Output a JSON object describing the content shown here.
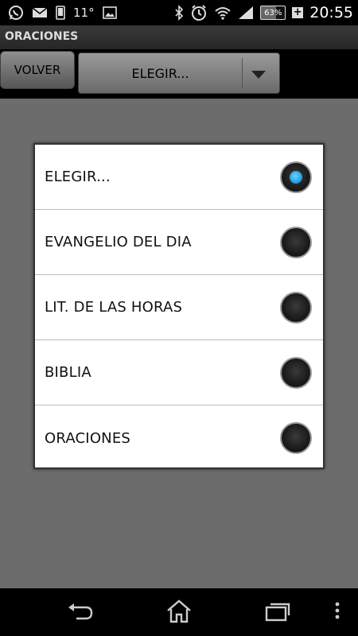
{
  "status_bar": {
    "temperature": "11°",
    "battery_percent": "63%",
    "time": "20:55",
    "icons": [
      "whatsapp-icon",
      "mail-icon",
      "phone-icon",
      "image-icon",
      "bluetooth-icon",
      "alarm-icon",
      "wifi-icon",
      "signal-icon",
      "battery-icon",
      "charging-icon"
    ]
  },
  "app": {
    "title": "ORACIONES"
  },
  "toolbar": {
    "back_label": "VOLVER",
    "spinner_value": "ELEGIR..."
  },
  "dialog": {
    "selected_index": 0,
    "options": [
      {
        "label": "ELEGIR..."
      },
      {
        "label": "EVANGELIO DEL DIA"
      },
      {
        "label": "LIT. DE LAS HORAS"
      },
      {
        "label": "BIBLIA"
      },
      {
        "label": "ORACIONES"
      }
    ]
  },
  "colors": {
    "accent": "#2aa5e8",
    "background_dim": "#6c6c6c",
    "dialog_bg": "#ffffff"
  },
  "navigation": {
    "icons": [
      "back-icon",
      "home-icon",
      "recent-apps-icon",
      "menu-icon"
    ]
  }
}
